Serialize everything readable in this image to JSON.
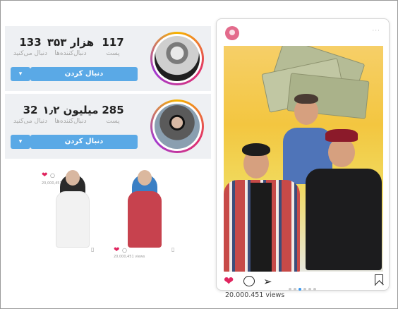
{
  "profiles": [
    {
      "posts_count": "117",
      "posts_label": "پست",
      "followers_count": "۳۵۳ هزار",
      "followers_label": "دنبال‌کننده‌ها",
      "following_count": "133",
      "following_label": "دنبال می‌کنید",
      "follow_label": "دنبال کردن",
      "dropdown_label": "▾"
    },
    {
      "posts_count": "285",
      "posts_label": "پست",
      "followers_count": "۱٫۲ میلیون",
      "followers_label": "دنبال‌کننده‌ها",
      "following_count": "32",
      "following_label": "دنبال می‌کنید",
      "follow_label": "دنبال کردن",
      "dropdown_label": "▾"
    }
  ],
  "mini_posts": [
    {
      "views": "20,000,451 views"
    },
    {
      "views": "20,000,451 views"
    }
  ],
  "post": {
    "views": "20.000.451 views",
    "more_label": "···",
    "carousel_dots": 6,
    "active_dot": 2
  },
  "icons": {
    "like": "heart-icon",
    "comment": "comment-icon",
    "share": "send-icon",
    "save": "bookmark-icon"
  },
  "colors": {
    "accent": "#5aa9e6",
    "like": "#e0245e",
    "active_dot": "#3897f0"
  }
}
